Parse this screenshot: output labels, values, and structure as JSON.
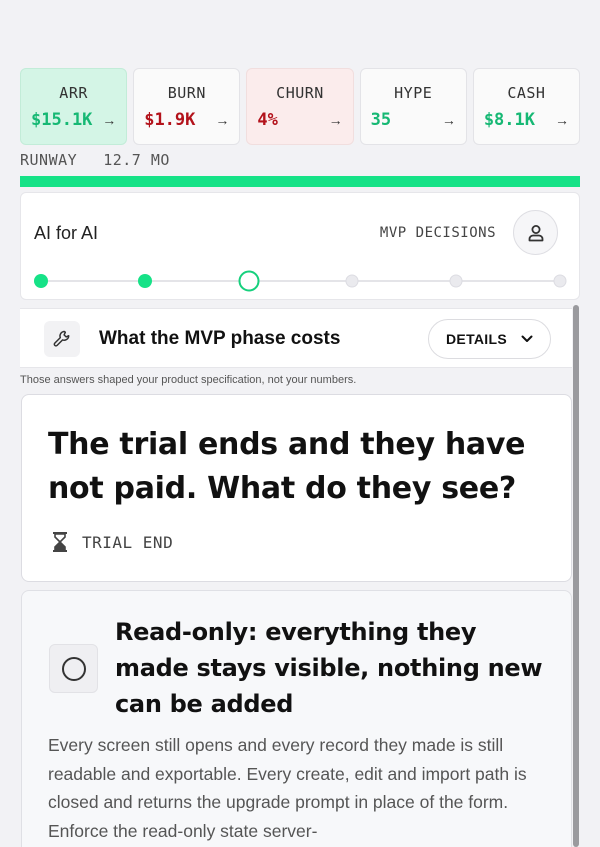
{
  "stats": [
    {
      "label": "ARR",
      "value": "$15.1K",
      "arrow": "→",
      "tone": "green"
    },
    {
      "label": "BURN",
      "value": "$1.9K",
      "arrow": "→",
      "tone": "red"
    },
    {
      "label": "CHURN",
      "value": "4%",
      "arrow": "→",
      "tone": "red"
    },
    {
      "label": "HYPE",
      "value": "35",
      "arrow": "→",
      "tone": "green"
    },
    {
      "label": "CASH",
      "value": "$8.1K",
      "arrow": "→",
      "tone": "green"
    }
  ],
  "runway": {
    "label": "RUNWAY",
    "value": "12.7 MO",
    "progress": 1.0
  },
  "progress_card": {
    "title": "AI for AI",
    "phase_label": "MVP DECISIONS",
    "steps": [
      "done",
      "done",
      "current",
      "todo",
      "todo",
      "todo"
    ]
  },
  "cost_card": {
    "title": "What the MVP phase costs",
    "details_label": "DETAILS"
  },
  "note": "Those answers shaped your product specification, not your numbers.",
  "question": {
    "text": "The trial ends and they have not paid. What do they see?",
    "tag": "TRIAL END"
  },
  "option": {
    "title": "Read-only: everything they made stays visible, nothing new can be added",
    "description": "Every screen still opens and every record they made is still readable and exportable. Every create, edit and import path is closed and returns the upgrade prompt in place of the form. Enforce the read-only state server-"
  },
  "colors": {
    "accent": "#16e287",
    "positive": "#16b874",
    "negative": "#b3121b"
  }
}
